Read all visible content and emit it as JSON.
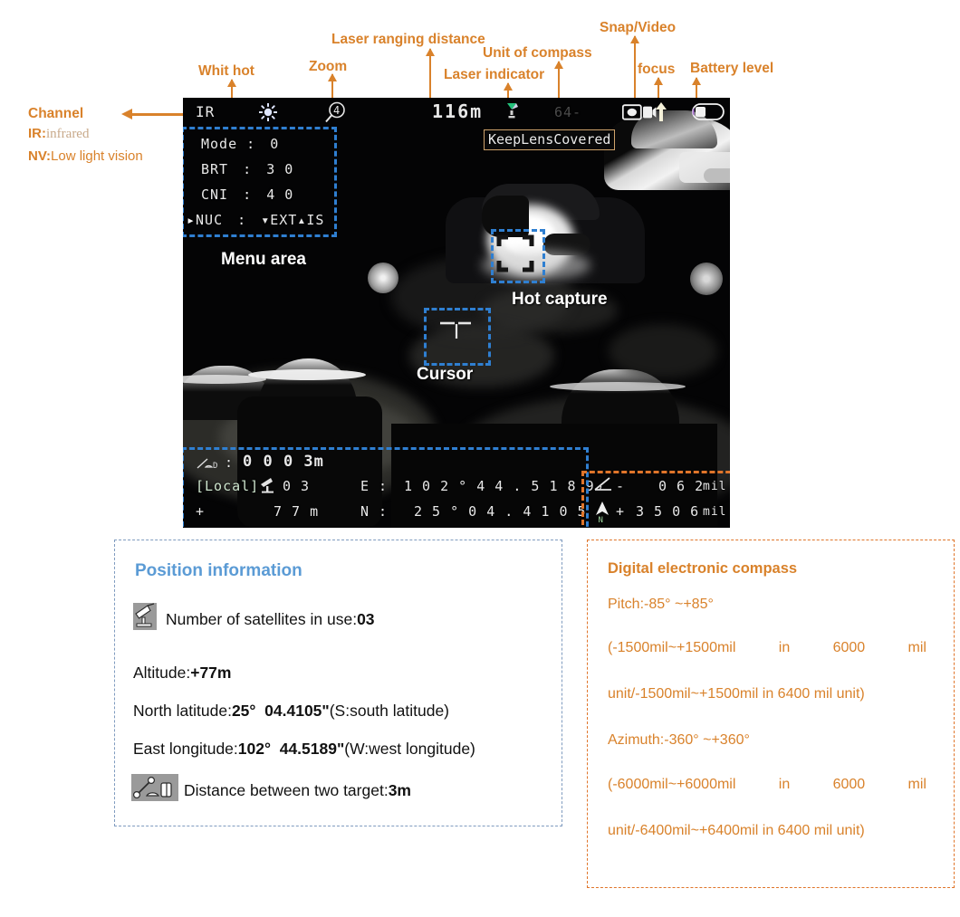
{
  "annotations": {
    "channel": {
      "title": "Channel",
      "line_ir": "IR:",
      "line_ir_val": "infrared",
      "line_nv": "NV:",
      "line_nv_val": "Low light vision"
    },
    "callouts": [
      {
        "name": "whit-hot",
        "label": "Whit hot"
      },
      {
        "name": "zoom",
        "label": "Zoom"
      },
      {
        "name": "laser-ranging-distance",
        "label": "Laser ranging distance"
      },
      {
        "name": "laser-indicator",
        "label": "Laser indicator"
      },
      {
        "name": "unit-of-compass",
        "label": "Unit of compass"
      },
      {
        "name": "snap-video",
        "label": "Snap/Video"
      },
      {
        "name": "focus",
        "label": "focus"
      },
      {
        "name": "battery-level",
        "label": "Battery level"
      }
    ],
    "in_image": {
      "menu_area": "Menu area",
      "hot_capture": "Hot capture",
      "cursor": "Cursor"
    }
  },
  "thermal": {
    "status": {
      "channel": "IR",
      "brightness_icon": "sun-icon",
      "zoom": "4",
      "laser_distance": "116m",
      "laser_indicator_icon": "laser-icon",
      "compass_unit": "64-",
      "snap_video_icon": "camera-video-icon",
      "focus_icon": "up-arrow-icon",
      "battery_icon": "battery-icon"
    },
    "warning": "KeepLensCovered",
    "menu": {
      "rows": [
        {
          "label": "Mode",
          "sep": ":",
          "value": "0"
        },
        {
          "label": "BRT",
          "sep": ":",
          "value": "3 0"
        },
        {
          "label": "CNI",
          "sep": ":",
          "value": "4 0"
        },
        {
          "label": "NUC",
          "sep": ":",
          "value": "EXT  IS",
          "selected": true
        }
      ]
    },
    "bottom": {
      "distance_label": "D",
      "distance_sep": ":",
      "distance_value": "0 0 0 3m",
      "local_tag": "[Local]",
      "satellites": "0 3",
      "east_label": "E :",
      "east_value": "1 0 2 ° 4 4 . 5 1 8 9",
      "altitude_sign": "+",
      "altitude_value": "7 7 m",
      "north_label": "N :",
      "north_value": "2 5 ° 0 4 . 4 1 0 5",
      "pitch_sign": "-",
      "pitch_value": "0 6 2",
      "pitch_unit": "mil",
      "azimuth_sign": "+",
      "azimuth_value": "3 5 0 6",
      "azimuth_unit": "mil"
    }
  },
  "position_box": {
    "title": "Position information",
    "satellites_icon": "satellite-dish-icon",
    "satellites_label": "Number of satellites in use:",
    "satellites_value": "03",
    "altitude_label": "Altitude:",
    "altitude_value": "+77m",
    "lat_label": "North latitude:",
    "lat_value_deg": "25°",
    "lat_value_min": "04.4105\"",
    "lat_note": "(S:south latitude)",
    "lon_label": "East longitude:",
    "lon_value_deg": "102°",
    "lon_value_min": "44.5189\"",
    "lon_note": "(W:west longitude)",
    "distance_icon": "distance-measure-icon",
    "distance_label": "Distance between two target:",
    "distance_value": "3m"
  },
  "compass_box": {
    "title": "Digital electronic compass",
    "pitch": "Pitch:-85°  ~+85°",
    "pitch_range_a1": "(-1500mil~+1500mil",
    "pitch_range_a2": "in",
    "pitch_range_a3": "6000",
    "pitch_range_a4": "mil",
    "pitch_range_b": "unit/-1500mil~+1500mil in 6400 mil unit)",
    "azimuth": "Azimuth:-360°  ~+360°",
    "azimuth_range_a1": "(-6000mil~+6000mil",
    "azimuth_range_a2": "in",
    "azimuth_range_a3": "6000",
    "azimuth_range_a4": "mil",
    "azimuth_range_b": "unit/-6400mil~+6400mil in 6400 mil unit)"
  },
  "colors": {
    "annotation": "#d9822b",
    "blue_dash": "#2f7fd1",
    "orange_dash": "#e0752a",
    "position_title": "#5b9bd5"
  }
}
